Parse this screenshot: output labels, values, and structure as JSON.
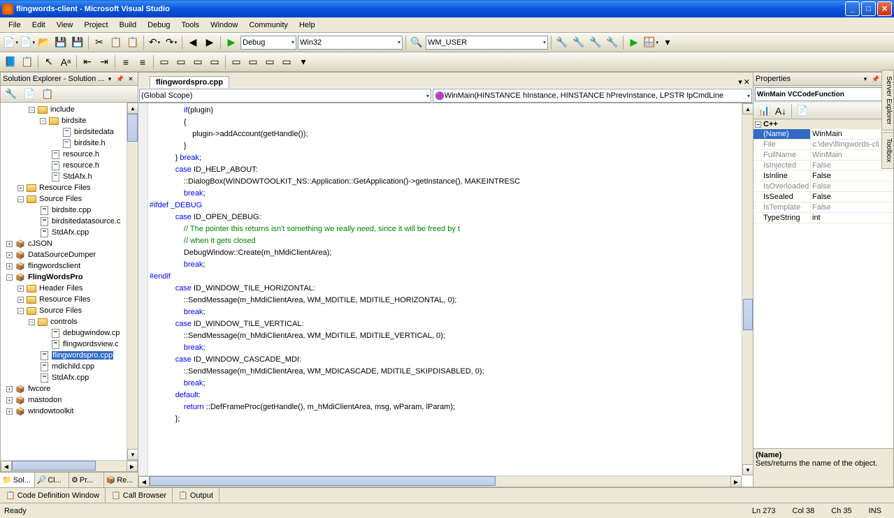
{
  "window": {
    "title": "flingwords-client - Microsoft Visual Studio"
  },
  "menu": [
    "File",
    "Edit",
    "View",
    "Project",
    "Build",
    "Debug",
    "Tools",
    "Window",
    "Community",
    "Help"
  ],
  "toolbar1": {
    "config": "Debug",
    "platform": "Win32",
    "find": "WM_USER"
  },
  "solution_explorer": {
    "title": "Solution Explorer - Solution ...",
    "tree": [
      {
        "depth": 2,
        "exp": "-",
        "icon": "folder",
        "label": "include"
      },
      {
        "depth": 3,
        "exp": "-",
        "icon": "folder",
        "label": "birdsite"
      },
      {
        "depth": 4,
        "exp": "",
        "icon": "h",
        "label": "birdsitedata"
      },
      {
        "depth": 4,
        "exp": "",
        "icon": "h",
        "label": "birdsite.h"
      },
      {
        "depth": 3,
        "exp": "",
        "icon": "h",
        "label": "resource.h"
      },
      {
        "depth": 3,
        "exp": "",
        "icon": "h",
        "label": "resource.h"
      },
      {
        "depth": 3,
        "exp": "",
        "icon": "h",
        "label": "StdAfx.h"
      },
      {
        "depth": 1,
        "exp": "+",
        "icon": "folder",
        "label": "Resource Files"
      },
      {
        "depth": 1,
        "exp": "-",
        "icon": "folder",
        "label": "Source Files"
      },
      {
        "depth": 2,
        "exp": "",
        "icon": "cpp",
        "label": "birdsite.cpp"
      },
      {
        "depth": 2,
        "exp": "",
        "icon": "cpp",
        "label": "birdsitedatasource.c"
      },
      {
        "depth": 2,
        "exp": "",
        "icon": "cpp",
        "label": "StdAfx.cpp"
      },
      {
        "depth": 0,
        "exp": "+",
        "icon": "proj",
        "label": "cJSON"
      },
      {
        "depth": 0,
        "exp": "+",
        "icon": "proj",
        "label": "DataSourceDumper"
      },
      {
        "depth": 0,
        "exp": "+",
        "icon": "proj",
        "label": "flingwordsclient"
      },
      {
        "depth": 0,
        "exp": "-",
        "icon": "proj",
        "label": "FlingWordsPro",
        "bold": true
      },
      {
        "depth": 1,
        "exp": "+",
        "icon": "folder",
        "label": "Header Files"
      },
      {
        "depth": 1,
        "exp": "+",
        "icon": "folder",
        "label": "Resource Files"
      },
      {
        "depth": 1,
        "exp": "-",
        "icon": "folder",
        "label": "Source Files"
      },
      {
        "depth": 2,
        "exp": "-",
        "icon": "folder",
        "label": "controls"
      },
      {
        "depth": 3,
        "exp": "",
        "icon": "cpp",
        "label": "debugwindow.cp"
      },
      {
        "depth": 3,
        "exp": "",
        "icon": "cpp",
        "label": "flingwordsview.c"
      },
      {
        "depth": 2,
        "exp": "",
        "icon": "cpp",
        "label": "flingwordspro.cpp",
        "selected": true
      },
      {
        "depth": 2,
        "exp": "",
        "icon": "cpp",
        "label": "mdichild.cpp"
      },
      {
        "depth": 2,
        "exp": "",
        "icon": "cpp",
        "label": "StdAfx.cpp"
      },
      {
        "depth": 0,
        "exp": "+",
        "icon": "proj",
        "label": "fwcore"
      },
      {
        "depth": 0,
        "exp": "+",
        "icon": "proj",
        "label": "mastodon"
      },
      {
        "depth": 0,
        "exp": "+",
        "icon": "proj",
        "label": "windowtoolkit"
      }
    ],
    "tabs": [
      {
        "icon": "📁",
        "label": "Sol...",
        "active": true
      },
      {
        "icon": "🔎",
        "label": "Cl..."
      },
      {
        "icon": "⚙",
        "label": "Pr..."
      },
      {
        "icon": "📦",
        "label": "Re..."
      }
    ]
  },
  "editor": {
    "tab": "flingwordspro.cpp",
    "scope": "(Global Scope)",
    "member": "WinMain(HINSTANCE hInstance, HINSTANCE hPrevInstance, LPSTR lpCmdLine",
    "code_lines": [
      {
        "t": "                if(plugin)",
        "k": [
          [
            16,
            18
          ]
        ]
      },
      {
        "t": "                {"
      },
      {
        "t": "                    plugin->addAccount(getHandle());"
      },
      {
        "t": "                }"
      },
      {
        "t": "            } break;",
        "k": [
          [
            14,
            19
          ]
        ]
      },
      {
        "t": "            case ID_HELP_ABOUT:",
        "k": [
          [
            12,
            16
          ]
        ]
      },
      {
        "t": "                ::DialogBox(WINDOWTOOLKIT_NS::Application::GetApplication()->getInstance(), MAKEINTRESC"
      },
      {
        "t": "                break;",
        "k": [
          [
            16,
            21
          ]
        ]
      },
      {
        "t": "#ifdef _DEBUG",
        "pp": true
      },
      {
        "t": "            case ID_OPEN_DEBUG:",
        "k": [
          [
            12,
            16
          ]
        ]
      },
      {
        "t": "                // The pointer this returns isn't something we really need, since it will be freed by t",
        "com": 16
      },
      {
        "t": "                // when it gets closed",
        "com": 16
      },
      {
        "t": "                DebugWindow::Create(m_hMdiClientArea);"
      },
      {
        "t": "                break;",
        "k": [
          [
            16,
            21
          ]
        ]
      },
      {
        "t": "#endif",
        "pp": true
      },
      {
        "t": "            case ID_WINDOW_TILE_HORIZONTAL:",
        "k": [
          [
            12,
            16
          ]
        ]
      },
      {
        "t": "                ::SendMessage(m_hMdiClientArea, WM_MDITILE, MDITILE_HORIZONTAL, 0);"
      },
      {
        "t": "                break;",
        "k": [
          [
            16,
            21
          ]
        ]
      },
      {
        "t": "            case ID_WINDOW_TILE_VERTICAL:",
        "k": [
          [
            12,
            16
          ]
        ]
      },
      {
        "t": "                ::SendMessage(m_hMdiClientArea, WM_MDITILE, MDITILE_VERTICAL, 0);"
      },
      {
        "t": "                break;",
        "k": [
          [
            16,
            21
          ]
        ]
      },
      {
        "t": "            case ID_WINDOW_CASCADE_MDI:",
        "k": [
          [
            12,
            16
          ]
        ]
      },
      {
        "t": "                ::SendMessage(m_hMdiClientArea, WM_MDICASCADE, MDITILE_SKIPDISABLED, 0);"
      },
      {
        "t": "                break;",
        "k": [
          [
            16,
            21
          ]
        ]
      },
      {
        "t": "            default:",
        "k": [
          [
            12,
            19
          ]
        ]
      },
      {
        "t": "                return ::DefFrameProc(getHandle(), m_hMdiClientArea, msg, wParam, lParam);",
        "k": [
          [
            16,
            22
          ]
        ]
      },
      {
        "t": "            };"
      }
    ]
  },
  "properties": {
    "title": "Properties",
    "object": "WinMain VCCodeFunction",
    "category": "C++",
    "rows": [
      {
        "name": "(Name)",
        "value": "WinMain",
        "enabled": true,
        "selected": true
      },
      {
        "name": "File",
        "value": "c:\\dev\\flingwords-cli"
      },
      {
        "name": "FullName",
        "value": "WinMain"
      },
      {
        "name": "IsInjected",
        "value": "False"
      },
      {
        "name": "IsInline",
        "value": "False",
        "enabled": true
      },
      {
        "name": "IsOverloaded",
        "value": "False"
      },
      {
        "name": "IsSealed",
        "value": "False",
        "enabled": true
      },
      {
        "name": "IsTemplate",
        "value": "False"
      },
      {
        "name": "TypeString",
        "value": "int",
        "enabled": true
      }
    ],
    "desc_name": "(Name)",
    "desc_text": "Sets/returns the name of the object."
  },
  "bottom_tabs": [
    "Code Definition Window",
    "Call Browser",
    "Output"
  ],
  "status": {
    "ready": "Ready",
    "ln": "Ln 273",
    "col": "Col 38",
    "ch": "Ch 35",
    "ins": "INS"
  },
  "vtabs": [
    "Server Explorer",
    "Toolbox"
  ]
}
